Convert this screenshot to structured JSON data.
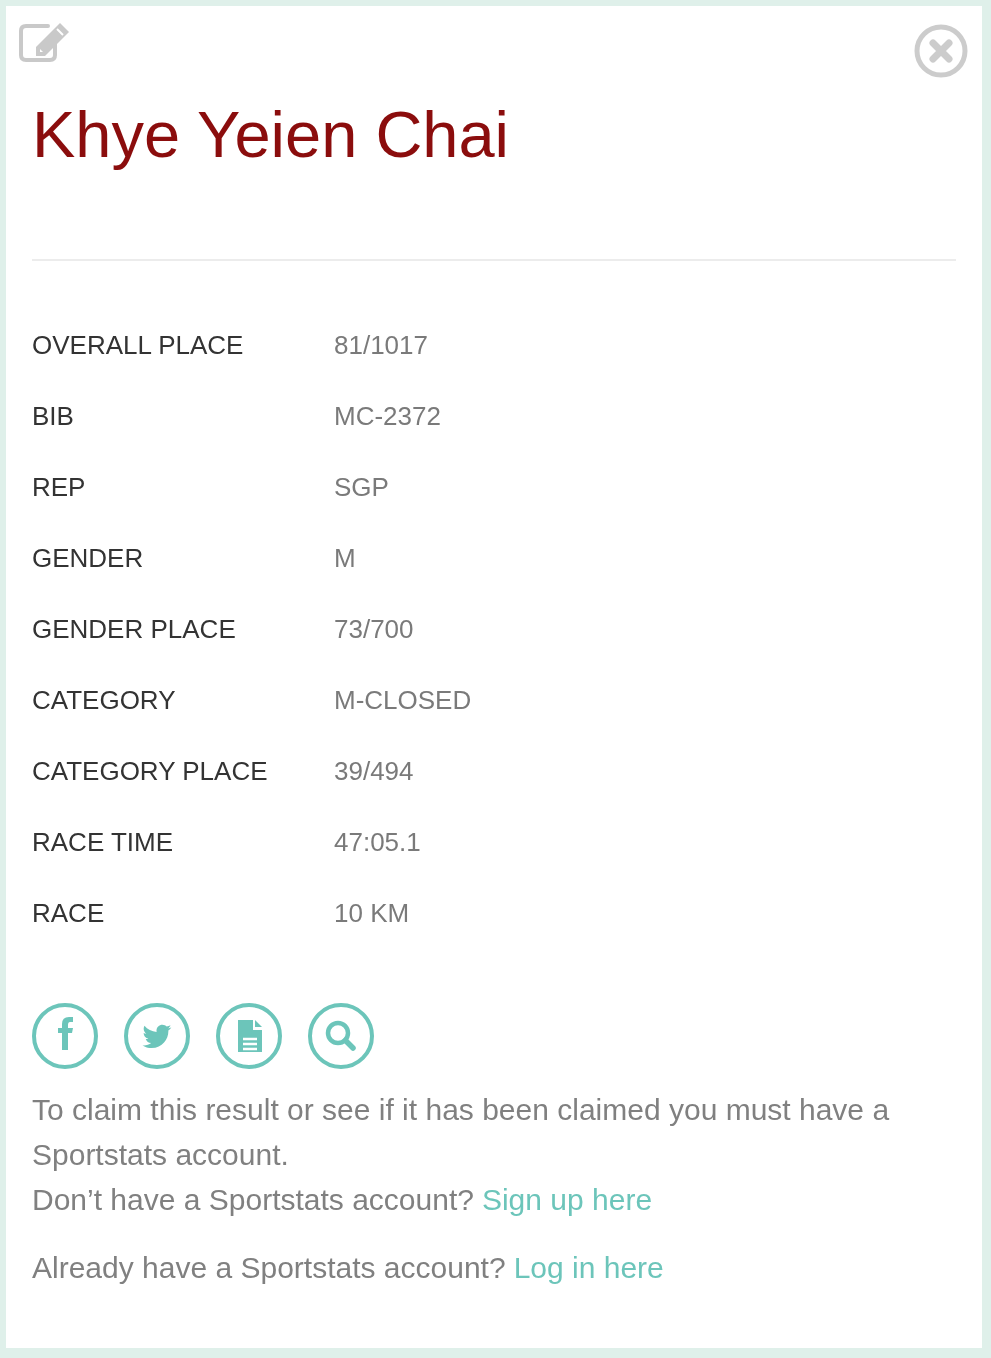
{
  "athlete_name": "Khye Yeien Chai",
  "details": [
    {
      "label": "OVERALL PLACE",
      "value": "81/1017"
    },
    {
      "label": "BIB",
      "value": "MC-2372"
    },
    {
      "label": "REP",
      "value": "SGP"
    },
    {
      "label": "GENDER",
      "value": "M"
    },
    {
      "label": "GENDER PLACE",
      "value": "73/700"
    },
    {
      "label": "CATEGORY",
      "value": "M-CLOSED"
    },
    {
      "label": "CATEGORY PLACE",
      "value": "39/494"
    },
    {
      "label": "RACE TIME",
      "value": "47:05.1"
    },
    {
      "label": "RACE",
      "value": "10 KM"
    }
  ],
  "claim_notice": {
    "text": "To claim this result or see if it has been claimed you must have a Sportstats account.",
    "signup_prompt": "Don’t have a Sportstats account?",
    "signup_link": "Sign up here",
    "login_prompt": "Already have a Sportstats account?",
    "login_link": "Log in here"
  }
}
